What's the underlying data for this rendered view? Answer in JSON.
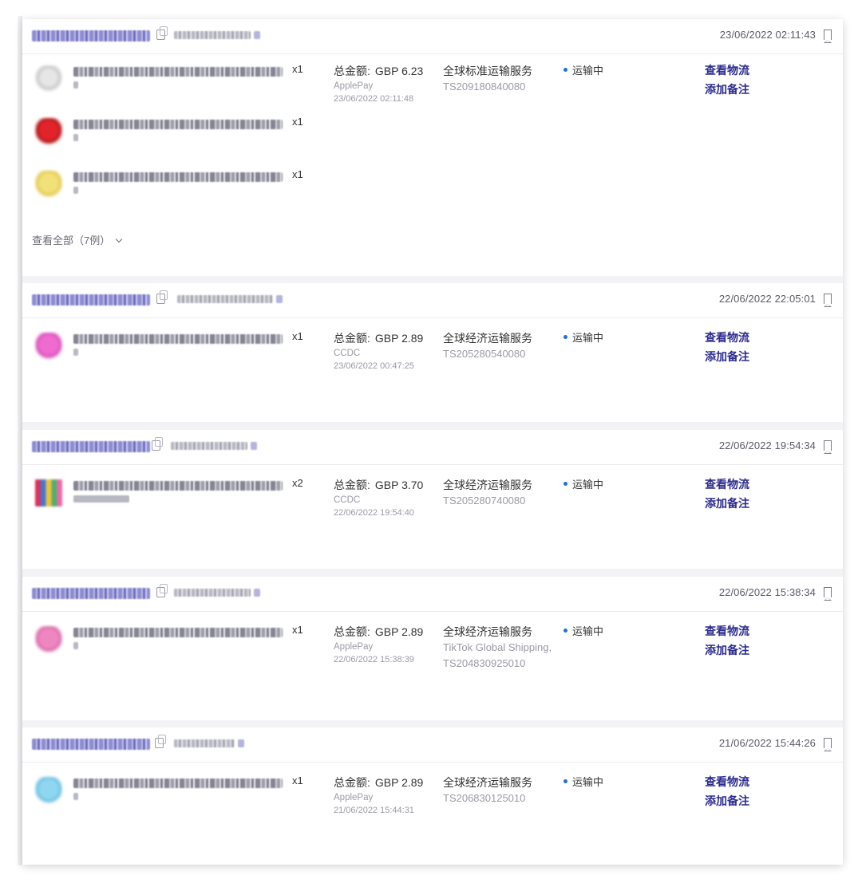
{
  "orders": [
    {
      "time": "23/06/2022 02:11:43",
      "qtys": [
        "x1",
        "x1",
        "x1"
      ],
      "amount_label": "总金额:",
      "amount": "GBP 6.23",
      "payment_method": "ApplePay",
      "payment_time": "23/06/2022 02:11:48",
      "shipping_service": "全球标准运输服务",
      "tracking": "TS209180840080",
      "status": "运输中",
      "action_view": "查看物流",
      "action_note": "添加备注",
      "view_all": "查看全部（7例）"
    },
    {
      "time": "22/06/2022 22:05:01",
      "qtys": [
        "x1"
      ],
      "amount_label": "总金额:",
      "amount": "GBP 2.89",
      "payment_method": "CCDC",
      "payment_time": "23/06/2022 00:47:25",
      "shipping_service": "全球经济运输服务",
      "tracking": "TS205280540080",
      "status": "运输中",
      "action_view": "查看物流",
      "action_note": "添加备注"
    },
    {
      "time": "22/06/2022 19:54:34",
      "qtys": [
        "x2"
      ],
      "amount_label": "总金额:",
      "amount": "GBP 3.70",
      "payment_method": "CCDC",
      "payment_time": "22/06/2022 19:54:40",
      "shipping_service": "全球经济运输服务",
      "tracking": "TS205280740080",
      "status": "运输中",
      "action_view": "查看物流",
      "action_note": "添加备注"
    },
    {
      "time": "22/06/2022 15:38:34",
      "qtys": [
        "x1"
      ],
      "amount_label": "总金额:",
      "amount": "GBP 2.89",
      "payment_method": "ApplePay",
      "payment_time": "22/06/2022 15:38:39",
      "shipping_service": "全球经济运输服务",
      "tracking": "TikTok Global Shipping,TS204830925010",
      "status": "运输中",
      "action_view": "查看物流",
      "action_note": "添加备注"
    },
    {
      "time": "21/06/2022 15:44:26",
      "qtys": [
        "x1"
      ],
      "amount_label": "总金额:",
      "amount": "GBP 2.89",
      "payment_method": "ApplePay",
      "payment_time": "21/06/2022 15:44:31",
      "shipping_service": "全球经济运输服务",
      "tracking": "TS206830125010",
      "status": "运输中",
      "action_view": "查看物流",
      "action_note": "添加备注"
    }
  ],
  "colors": {
    "link": "#2b2a8e",
    "status_dot": "#1e6fe0",
    "muted": "#9a9aa6",
    "panel_bg": "#f3f3f6"
  },
  "icons": [
    "copy-icon",
    "bookmark-icon",
    "status-dot",
    "chevron-down-icon"
  ]
}
